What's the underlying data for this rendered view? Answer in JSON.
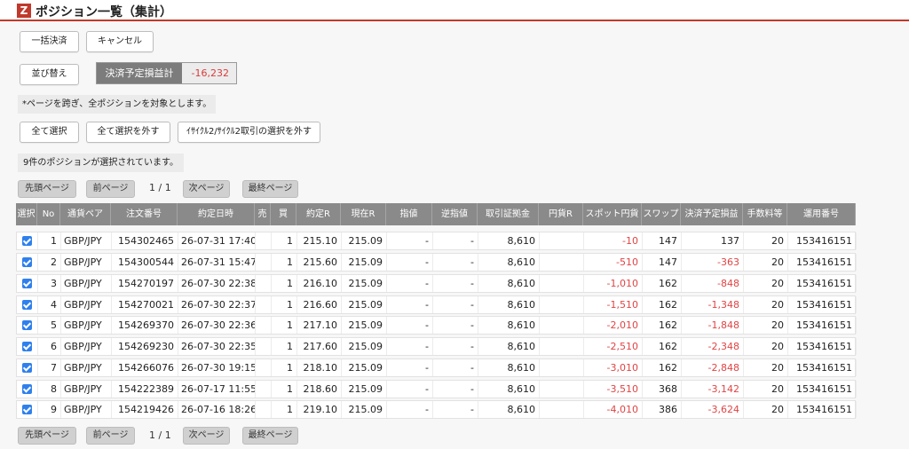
{
  "header": {
    "logo": "Z",
    "title": "ポジション一覧（集計）"
  },
  "actions": {
    "bulk_settle": "一括決済",
    "cancel": "キャンセル",
    "sort": "並び替え"
  },
  "pl": {
    "label": "決済予定損益計",
    "value": "-16,232"
  },
  "note": "*ページを跨ぎ、全ポジションを対象とします。",
  "select": {
    "select_all": "全て選択",
    "deselect_all": "全て選択を外す",
    "deselect_cycle": "ｲｻｲｸﾙ2/ｻｲｸﾙ2取引の選択を外す"
  },
  "selected_note": "9件のポジションが選択されています。",
  "pager": {
    "first": "先頭ページ",
    "prev": "前ページ",
    "page": "1 / 1",
    "next": "次ページ",
    "last": "最終ページ"
  },
  "table": {
    "headers": [
      "選択",
      "No",
      "通貨ペア",
      "注文番号",
      "約定日時",
      "売",
      "買",
      "約定R",
      "現在R",
      "指値",
      "逆指値",
      "取引証拠金",
      "円貨R",
      "スポット円貨",
      "スワップ",
      "決済予定損益",
      "手数料等",
      "運用番号"
    ],
    "rows": [
      [
        "1",
        "GBP/JPY",
        "154302465",
        "26-07-31 17:40",
        "",
        "1",
        "215.10",
        "215.09",
        "-",
        "-",
        "8,610",
        "",
        "-10",
        "147",
        "137",
        "20",
        "153416151"
      ],
      [
        "2",
        "GBP/JPY",
        "154300544",
        "26-07-31 15:47",
        "",
        "1",
        "215.60",
        "215.09",
        "-",
        "-",
        "8,610",
        "",
        "-510",
        "147",
        "-363",
        "20",
        "153416151"
      ],
      [
        "3",
        "GBP/JPY",
        "154270197",
        "26-07-30 22:38",
        "",
        "1",
        "216.10",
        "215.09",
        "-",
        "-",
        "8,610",
        "",
        "-1,010",
        "162",
        "-848",
        "20",
        "153416151"
      ],
      [
        "4",
        "GBP/JPY",
        "154270021",
        "26-07-30 22:37",
        "",
        "1",
        "216.60",
        "215.09",
        "-",
        "-",
        "8,610",
        "",
        "-1,510",
        "162",
        "-1,348",
        "20",
        "153416151"
      ],
      [
        "5",
        "GBP/JPY",
        "154269370",
        "26-07-30 22:36",
        "",
        "1",
        "217.10",
        "215.09",
        "-",
        "-",
        "8,610",
        "",
        "-2,010",
        "162",
        "-1,848",
        "20",
        "153416151"
      ],
      [
        "6",
        "GBP/JPY",
        "154269230",
        "26-07-30 22:35",
        "",
        "1",
        "217.60",
        "215.09",
        "-",
        "-",
        "8,610",
        "",
        "-2,510",
        "162",
        "-2,348",
        "20",
        "153416151"
      ],
      [
        "7",
        "GBP/JPY",
        "154266076",
        "26-07-30 19:15",
        "",
        "1",
        "218.10",
        "215.09",
        "-",
        "-",
        "8,610",
        "",
        "-3,010",
        "162",
        "-2,848",
        "20",
        "153416151"
      ],
      [
        "8",
        "GBP/JPY",
        "154222389",
        "26-07-17 11:55",
        "",
        "1",
        "218.60",
        "215.09",
        "-",
        "-",
        "8,610",
        "",
        "-3,510",
        "368",
        "-3,142",
        "20",
        "153416151"
      ],
      [
        "9",
        "GBP/JPY",
        "154219426",
        "26-07-16 18:26",
        "",
        "1",
        "219.10",
        "215.09",
        "-",
        "-",
        "8,610",
        "",
        "-4,010",
        "386",
        "-3,624",
        "20",
        "153416151"
      ]
    ]
  },
  "colors": {
    "accent": "#c0392b",
    "negative": "#e04444",
    "checkbox": "#2f80ed"
  }
}
